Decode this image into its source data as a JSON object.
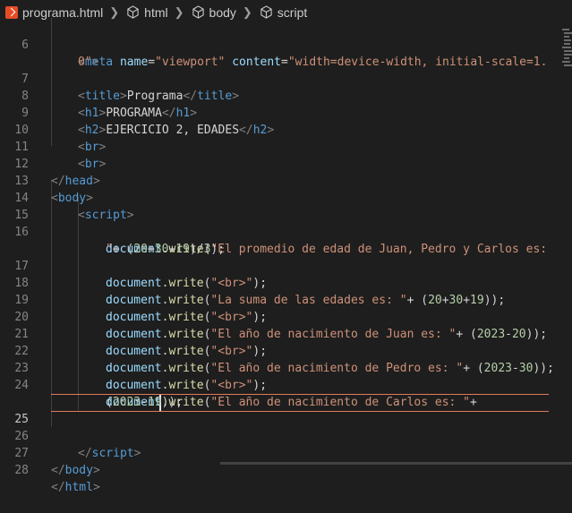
{
  "breadcrumb": {
    "file": "programa.html",
    "items": [
      "html",
      "body",
      "script"
    ]
  },
  "lines": {
    "6": "6",
    "7": "7",
    "8": "8",
    "9": "9",
    "10": "10",
    "11": "11",
    "12": "12",
    "13": "13",
    "14": "14",
    "15": "15",
    "16": "16",
    "17": "17",
    "18": "18",
    "19": "19",
    "20": "20",
    "21": "21",
    "22": "22",
    "23": "23",
    "24": "24",
    "25": "25",
    "26": "26",
    "27": "27",
    "28": "28"
  },
  "code": {
    "l6a_tag": "meta",
    "l6a_attr1": "name",
    "l6a_val1": "\"viewport\"",
    "l6a_attr2": "content",
    "l6a_val2": "\"width=device-width, initial-scale=1.",
    "l6b_val": "0\"",
    "l7_open": "title",
    "l7_text": "Programa",
    "l7_close": "title",
    "l8_open": "h1",
    "l8_text": "PROGRAMA",
    "l8_close": "h1",
    "l9_open": "h2",
    "l9_text": "EJERCICIO 2, EDADES",
    "l9_close": "h2",
    "l10_tag": "br",
    "l11_tag": "br",
    "l12_tag": "head",
    "l13_tag": "body",
    "l14_tag": "script",
    "l16a_str": "\"El promedio de edad de Juan, Pedro y Carlos es:",
    "l16b_str": "\"",
    "l16b_n1": "20",
    "l16b_n2": "30",
    "l16b_n3": "19",
    "l16b_n4": "3",
    "l17_str": "\"<br>\"",
    "l18_str": "\"La suma de las edades es: \"",
    "l18_n1": "20",
    "l18_n2": "30",
    "l18_n3": "19",
    "l19_str": "\"<br>\"",
    "l20_str": "\"El año de nacimiento de Juan es: \"",
    "l20_n1": "2023",
    "l20_n2": "20",
    "l21_str": "\"<br>\"",
    "l22_str": "\"El año de nacimiento de Pedro es: \"",
    "l22_n1": "2023",
    "l22_n2": "30",
    "l23_str": "\"<br>\"",
    "l24a_str": "\"El año de nacimiento de Carlos es: \"",
    "l24b_n1": "2023",
    "l24b_n2": "19",
    "l26_tag": "script",
    "l27_tag": "body",
    "l28_tag": "html",
    "obj": "document",
    "fn": "write"
  },
  "colors": {
    "background": "#1e1e1e",
    "tag": "#569cd6",
    "attribute": "#9cdcfe",
    "string": "#ce9178",
    "function": "#dcdcaa",
    "number": "#b5cea8",
    "current_line_border": "#e07a5f"
  }
}
